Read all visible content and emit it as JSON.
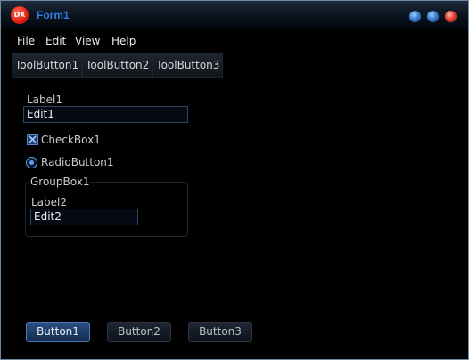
{
  "window": {
    "title": "Form1",
    "logo_text": "DX"
  },
  "menu": [
    "File",
    "Edit",
    "View",
    "Help"
  ],
  "toolbar": [
    "ToolButton1",
    "ToolButton2",
    "ToolButton3"
  ],
  "form": {
    "label1": "Label1",
    "edit1": "Edit1",
    "checkbox1": {
      "label": "CheckBox1",
      "checked": true
    },
    "radio1": {
      "label": "RadioButton1",
      "selected": true
    },
    "groupbox1": {
      "caption": "GroupBox1",
      "label2": "Label2",
      "edit2": "Edit2"
    }
  },
  "buttons": [
    "Button1",
    "Button2",
    "Button3"
  ],
  "colors": {
    "background": "#000000",
    "title_text": "#2f7fe0",
    "accent": "#4d78b4",
    "close_button": "#e6452f"
  }
}
